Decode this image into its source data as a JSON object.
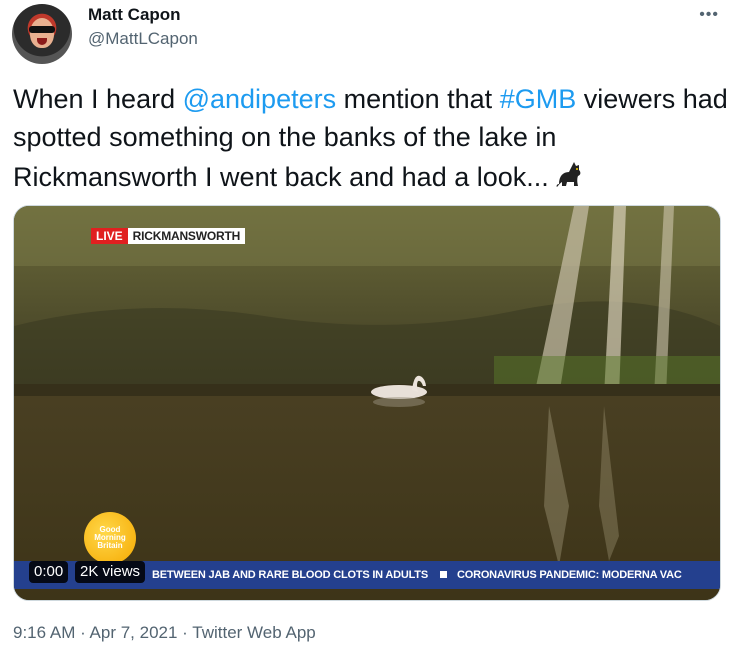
{
  "author": {
    "name": "Matt Capon",
    "handle": "@MattLCapon",
    "avatar_icon": "avatar-photo"
  },
  "more_icon": "more-dots-icon",
  "more_glyph": "•••",
  "tweet": {
    "part1": "When I heard ",
    "mention": "@andipeters",
    "part2": " mention that ",
    "hashtag": "#GMB",
    "part3": " viewers had spotted something on the banks of the lake in Rickmansworth I went back and had a look...",
    "emoji_icon": "black-cat-icon"
  },
  "video": {
    "live_tag": "LIVE",
    "location": "RICKMANSWORTH",
    "logo_text": "Good Morning Britain",
    "ticker": "BETWEEN JAB AND RARE BLOOD CLOTS IN ADULTS",
    "ticker2": "CORONAVIRUS PANDEMIC: MODERNA VAC",
    "time": "0:00",
    "views": "2K views"
  },
  "meta": {
    "time": "9:16 AM",
    "sep": " · ",
    "date": "Apr 7, 2021",
    "source": "Twitter Web App"
  },
  "colors": {
    "link": "#1d9bf0",
    "ticker_bg": "#24408e",
    "live_red": "#e02020"
  }
}
